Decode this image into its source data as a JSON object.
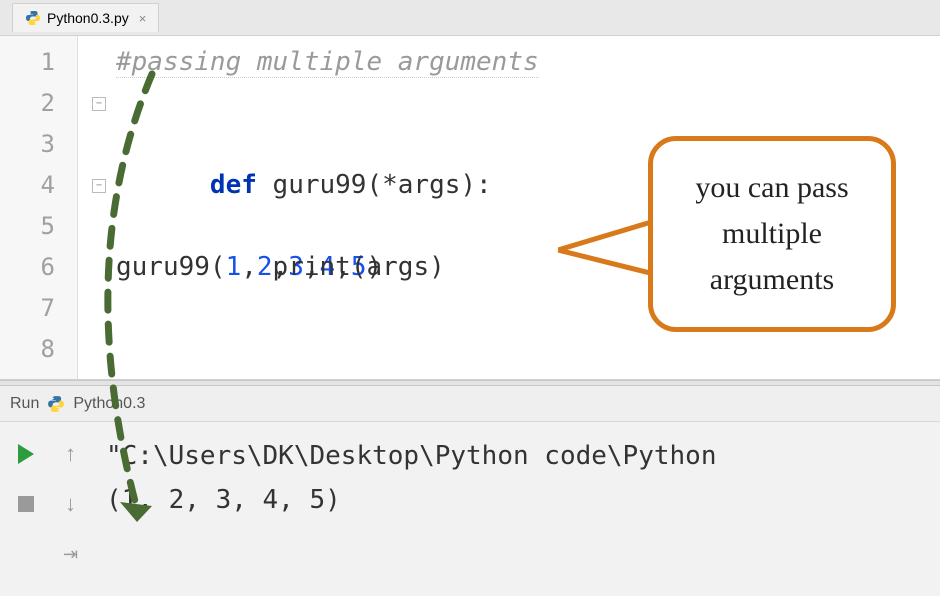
{
  "tab": {
    "label": "Python0.3.py"
  },
  "editor": {
    "lines": [
      "1",
      "2",
      "3",
      "4",
      "5",
      "6",
      "7",
      "8"
    ],
    "comment": "#passing multiple arguments",
    "def_kw": "def",
    "fn_name": " guru99",
    "def_sig_rest": "(*args)",
    "colon": ":",
    "print_indent": "    ",
    "print_call": "print",
    "print_args": "(args)",
    "call_name": "guru99",
    "call_open": "(",
    "n1": "1",
    "n2": "2",
    "n3": "3",
    "n4": "4",
    "n5": "5",
    "comma": ",",
    "call_close": ")"
  },
  "callout": {
    "text": "you can pass multiple arguments"
  },
  "run": {
    "label": "Run",
    "config": "Python0.3"
  },
  "console": {
    "line1": "\"C:\\Users\\DK\\Desktop\\Python code\\Python",
    "line2": "(1, 2, 3, 4, 5)"
  }
}
